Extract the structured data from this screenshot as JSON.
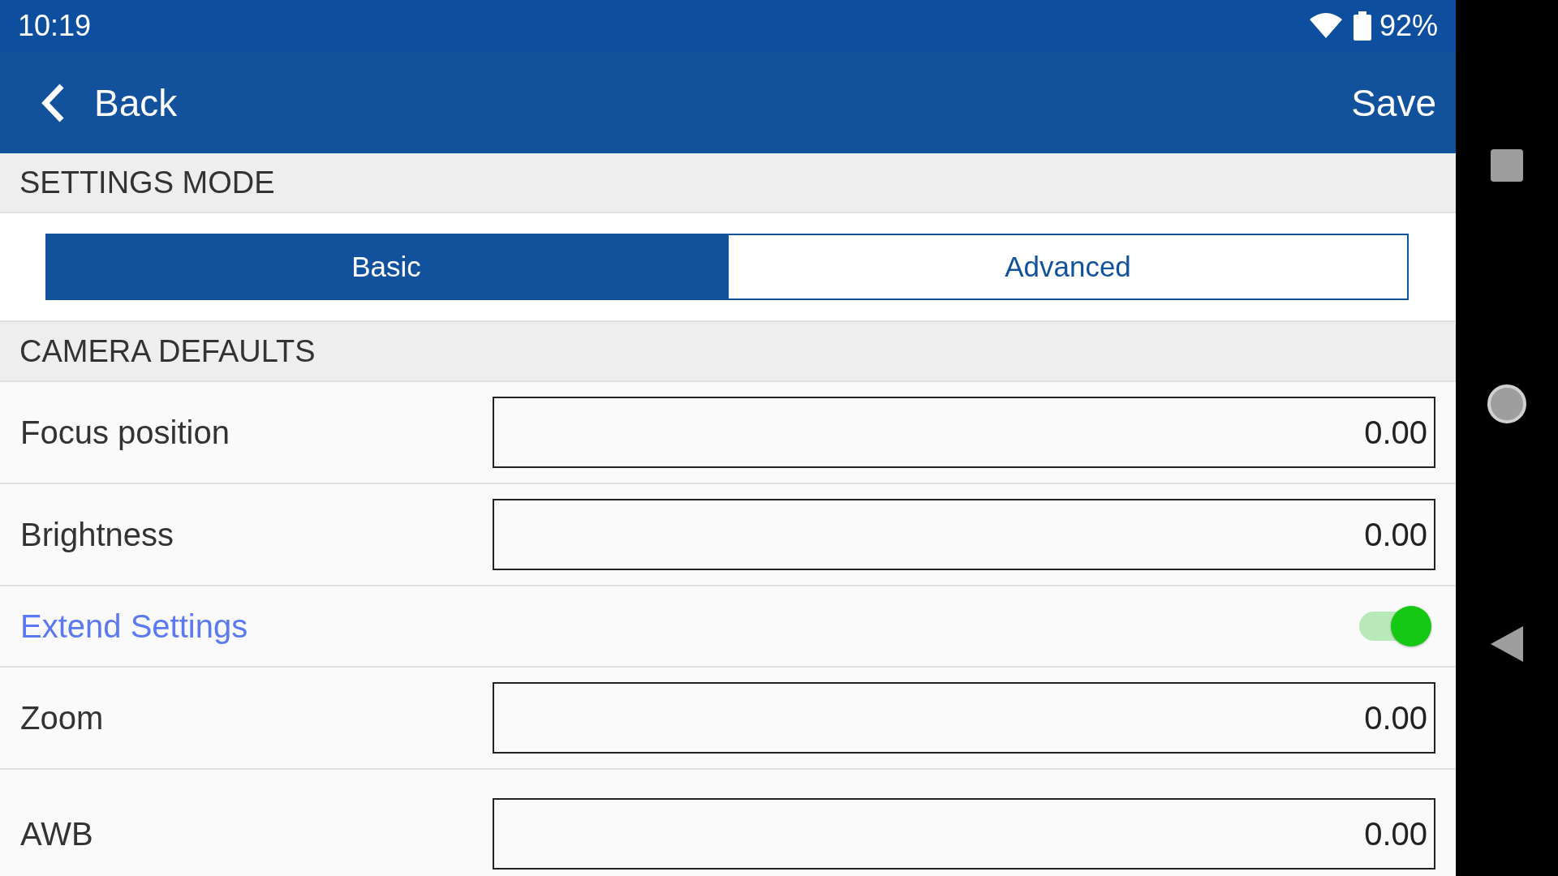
{
  "status_bar": {
    "time": "10:19",
    "battery": "92%"
  },
  "app_bar": {
    "back": "Back",
    "action": "Save"
  },
  "sections": [
    {
      "title": "SETTINGS MODE",
      "kind": "segments",
      "segments": [
        {
          "label": "Basic",
          "selected": true
        },
        {
          "label": "Advanced",
          "selected": false
        }
      ]
    },
    {
      "title": "CAMERA DEFAULTS",
      "kind": "rows",
      "rows": [
        {
          "kind": "field",
          "label": "Focus position",
          "value": "0.00"
        },
        {
          "kind": "field",
          "label": "Brightness",
          "value": "0.00"
        },
        {
          "kind": "toggle",
          "label": "Extend Settings",
          "on": true
        },
        {
          "kind": "field",
          "label": "Zoom",
          "value": "0.00"
        },
        {
          "kind": "field",
          "label": "AWB",
          "value": "0.00"
        }
      ]
    }
  ]
}
